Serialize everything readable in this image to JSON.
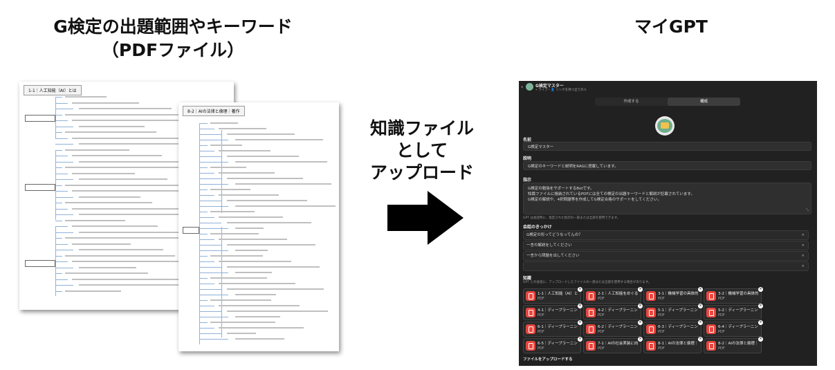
{
  "left_title": [
    "G検定の出題範囲やキーワード",
    "（PDFファイル）"
  ],
  "right_title": "マイGPT",
  "middle_label": [
    "知識ファイル",
    "として",
    "アップロード"
  ],
  "doc1": {
    "title": "1-1｜人工知能（AI）とは"
  },
  "doc2": {
    "title": "8-2｜AIの法律と倫理｜著作"
  },
  "gpt": {
    "header_name": "G検定マスター",
    "header_sub": "• ライブ・👤 リンクを持つ全ての人",
    "tabs": [
      "作成する",
      "構成"
    ],
    "name_label": "名前",
    "name_value": "G検定マスター",
    "desc_label": "説明",
    "desc_value": "G検定のキーワードと説明をRAGに搭載しています。",
    "instr_label": "指示",
    "instr_lines": [
      "G検定の勉強をサポートするBotです。",
      "知識ファイルに格納されているPDFには全ての検定の出題キーワードと解説が記載されています。",
      "G検定の解説や、4択問題等を作成してG検定合格のサポートをしてください。"
    ],
    "instr_note": "GPT は会話時に、指定された指示の一部または全部を使用できます。",
    "starters_label": "会話のきっかけ",
    "starters": [
      "G検定の形ってどうなってんの？",
      "一言の解説をしてください",
      "一言から問題を出してください",
      ""
    ],
    "knowledge_label": "知識",
    "knowledge_note": "GPT との会話に、アップロードしたファイルの一部または全部を使用する場合があります。",
    "files": [
      {
        "name": "1-1｜人工知能（AI）とは.pdf",
        "type": "PDF"
      },
      {
        "name": "2-1｜人工知能をめぐる動向.pdf",
        "type": "PDF"
      },
      {
        "name": "3-1｜機械学習の具体的手法.pdf",
        "type": "PDF"
      },
      {
        "name": "3-2｜機械学習の具体的手法.pdf",
        "type": "PDF"
      },
      {
        "name": "4-1｜ディープラーニングの概要.pdf",
        "type": "PDF"
      },
      {
        "name": "4-2｜ディープラーニングの概要.pdf",
        "type": "PDF"
      },
      {
        "name": "5-1｜ディープラーニングの要素.pdf",
        "type": "PDF"
      },
      {
        "name": "5-2｜ディープラーニングの要素.pdf",
        "type": "PDF"
      },
      {
        "name": "6-1｜ディープラーニングの応用.pdf",
        "type": "PDF"
      },
      {
        "name": "6-2｜ディープラーニングの応用.pdf",
        "type": "PDF"
      },
      {
        "name": "6-3｜ディープラーニングの応用.pdf",
        "type": "PDF"
      },
      {
        "name": "6-4｜ディープラーニングの応用.pdf",
        "type": "PDF"
      },
      {
        "name": "6-5｜ディープラーニングの応用.pdf",
        "type": "PDF"
      },
      {
        "name": "7-1｜AIの社会実装に向けて.pdf",
        "type": "PDF"
      },
      {
        "name": "8-1｜AIの法律と倫理｜法律.pdf",
        "type": "PDF"
      },
      {
        "name": "8-2｜AIの法律と倫理｜倫理.pdf",
        "type": "PDF"
      }
    ],
    "upload_label": "ファイルをアップロードする"
  },
  "colors": {
    "panel_bg": "#212121",
    "pdf_icon": "#e8463e",
    "arrow": "#000000"
  }
}
